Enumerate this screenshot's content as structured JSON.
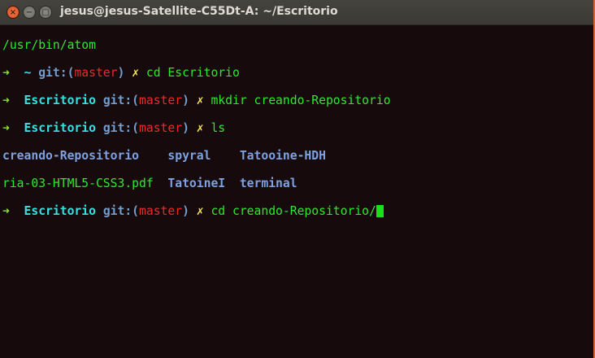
{
  "window": {
    "title": "jesus@jesus-Satellite-C55Dt-A: ~/Escritorio",
    "close": "×",
    "minimize": "−",
    "maximize": "□"
  },
  "terminal": {
    "line0": "/usr/bin/atom",
    "prompts": [
      {
        "arrow": "➜",
        "dir": "~",
        "git": "git:(",
        "branch": "master",
        "git_end": ")",
        "dirty": "✗",
        "cmd": "cd Escritorio"
      },
      {
        "arrow": "➜",
        "dir": "Escritorio",
        "git": "git:(",
        "branch": "master",
        "git_end": ")",
        "dirty": "✗",
        "cmd": "mkdir creando-Repositorio"
      },
      {
        "arrow": "➜",
        "dir": "Escritorio",
        "git": "git:(",
        "branch": "master",
        "git_end": ")",
        "dirty": "✗",
        "cmd": "ls"
      },
      {
        "arrow": "➜",
        "dir": "Escritorio",
        "git": "git:(",
        "branch": "master",
        "git_end": ")",
        "dirty": "✗",
        "cmd": "cd creando-Repositorio/"
      }
    ],
    "ls": [
      [
        "creando-Repositorio",
        "spyral",
        "Tatooine-HDH"
      ],
      [
        "ria-03-HTML5-CSS3.pdf",
        "TatoineI",
        "terminal"
      ]
    ]
  }
}
